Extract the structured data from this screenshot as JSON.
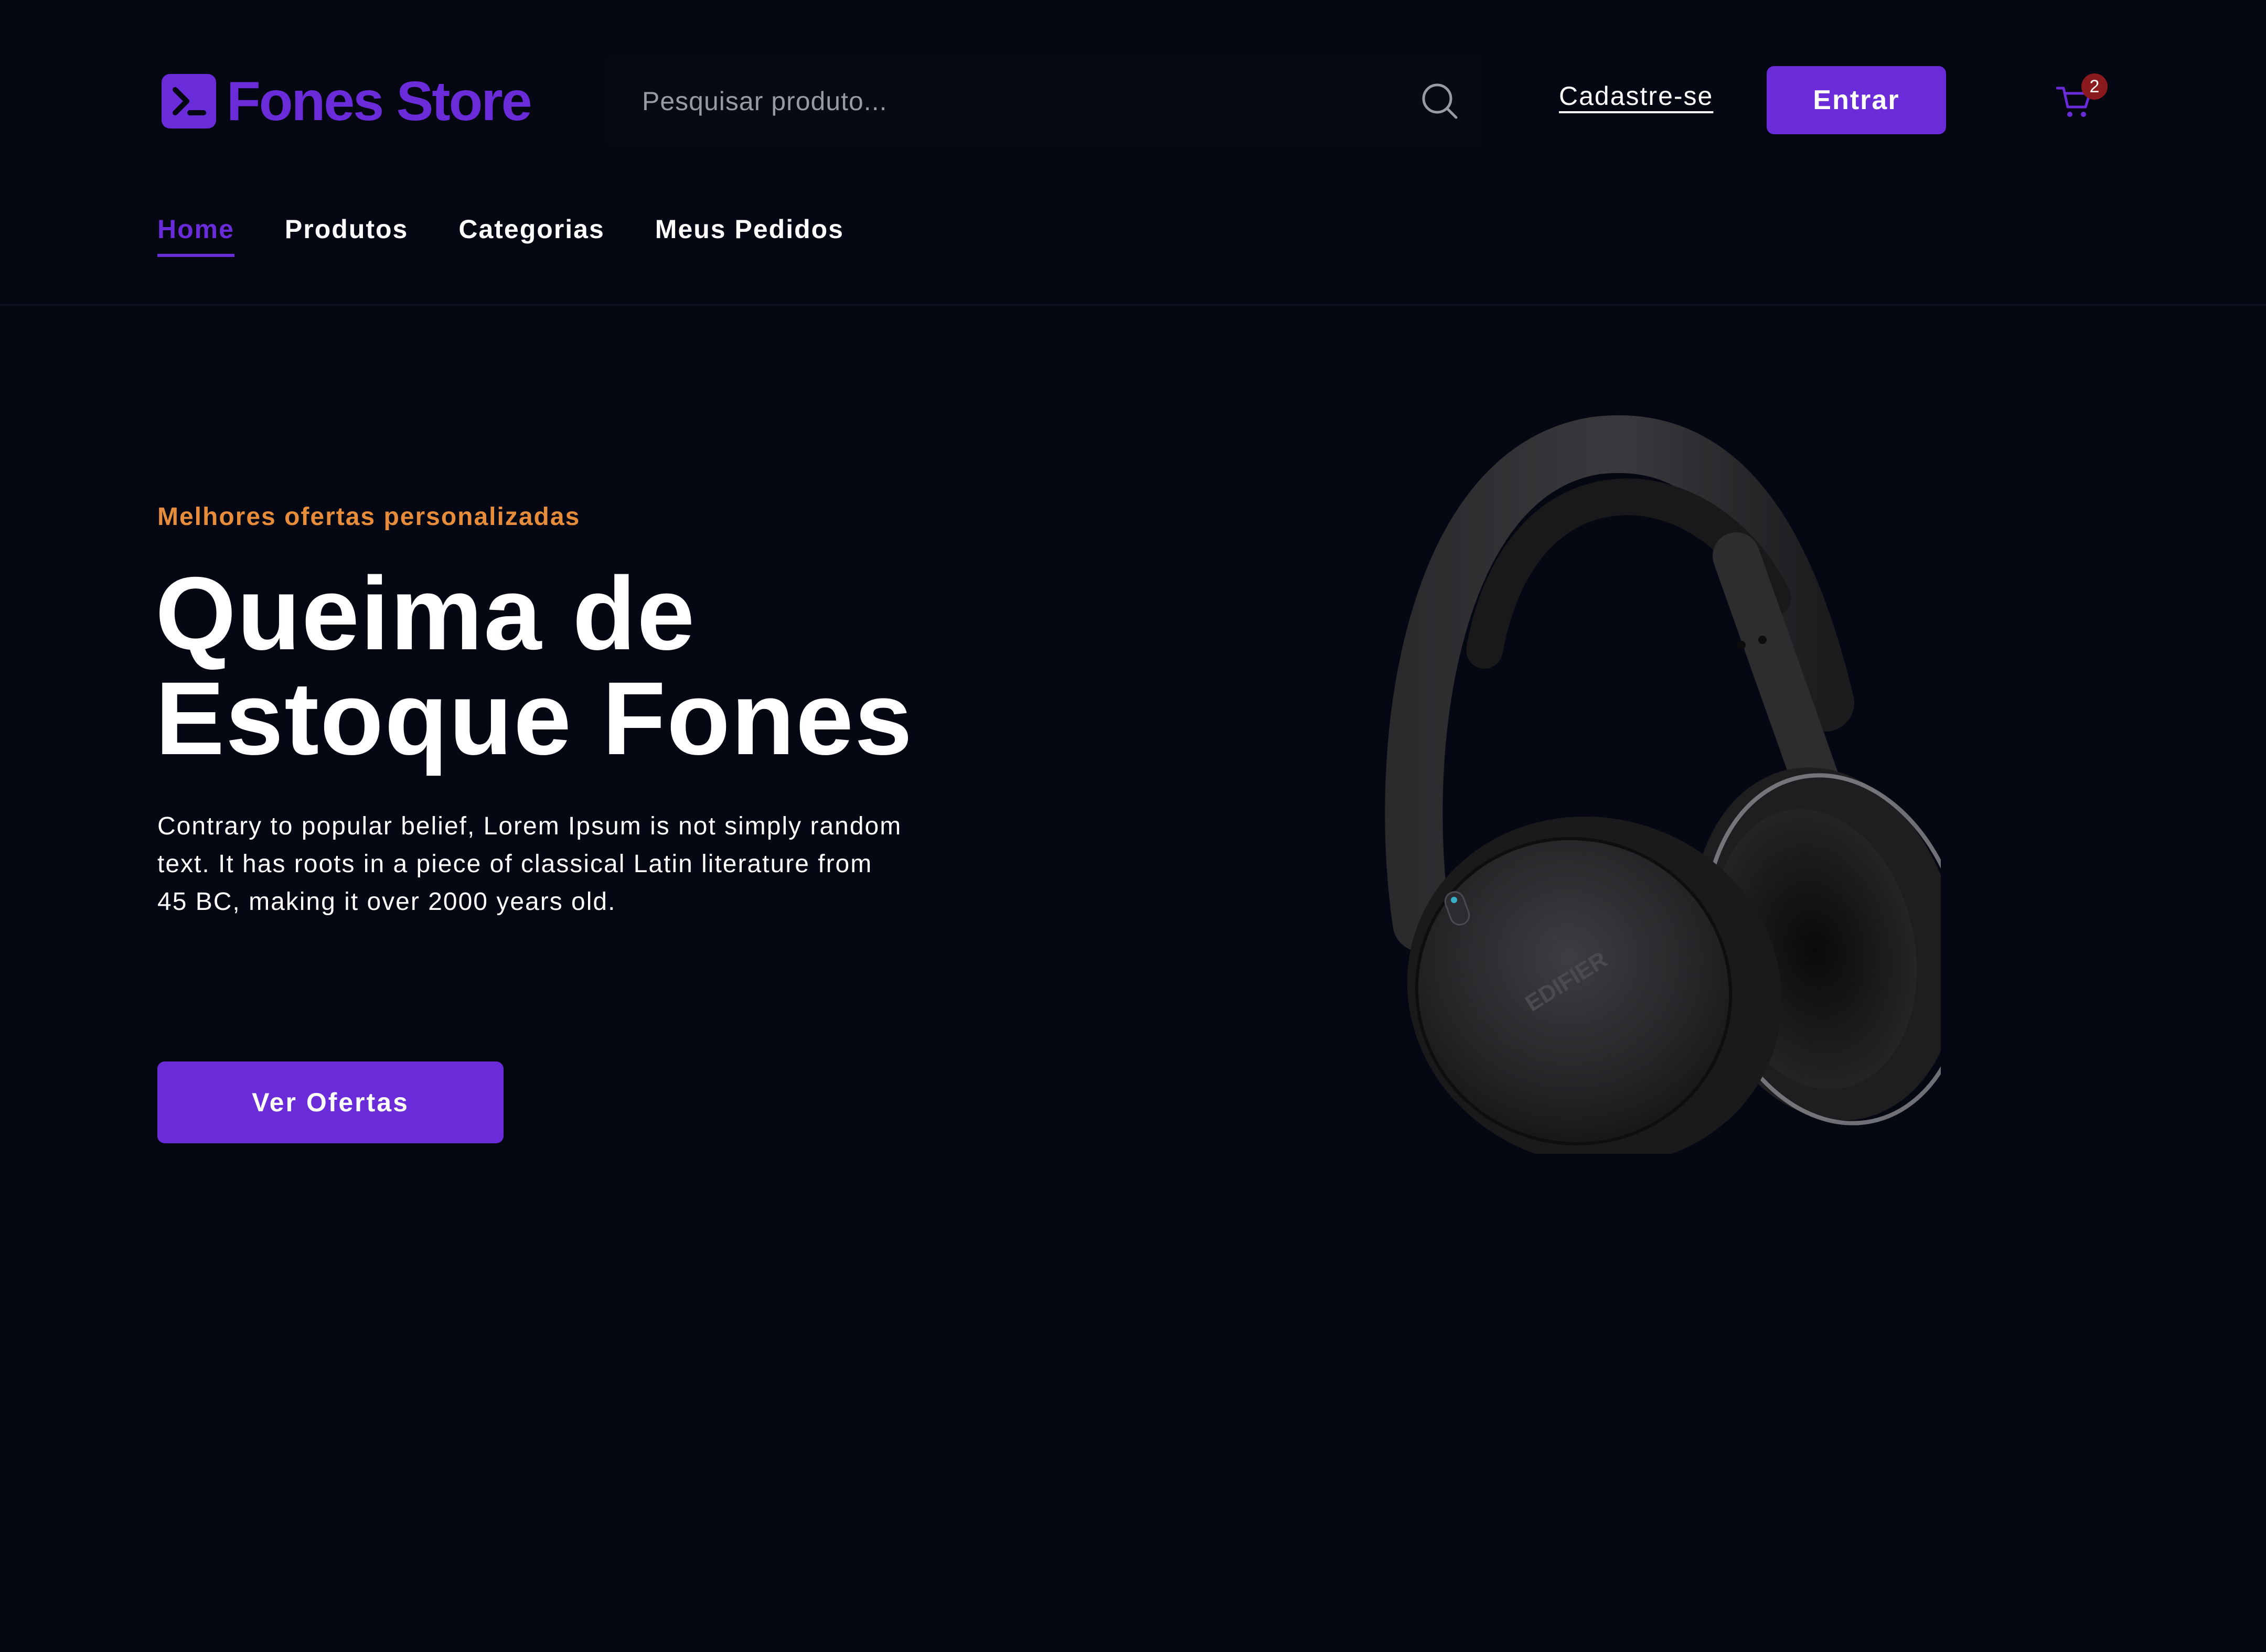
{
  "brand": {
    "name": "Fones Store",
    "accent": "#6a2bd9",
    "logo_icon": "terminal-prompt-icon"
  },
  "search": {
    "placeholder": "Pesquisar produto...",
    "icon": "search-icon"
  },
  "header": {
    "signup_label": "Cadastre-se",
    "login_label": "Entrar",
    "cart_icon": "cart-icon",
    "cart_count": "2"
  },
  "nav": {
    "items": [
      {
        "label": "Home",
        "active": true
      },
      {
        "label": "Produtos",
        "active": false
      },
      {
        "label": "Categorias",
        "active": false
      },
      {
        "label": "Meus Pedidos",
        "active": false
      }
    ]
  },
  "hero": {
    "eyebrow": "Melhores ofertas personalizadas",
    "title_line1": "Queima de",
    "title_line2": "Estoque Fones",
    "description": "Contrary to popular belief, Lorem Ipsum is not simply random text. It has roots in a piece of classical Latin literature from 45 BC, making it over 2000 years old.",
    "cta_label": "Ver Ofertas",
    "image_brand_text": "EDIFIER",
    "eyebrow_color": "#e68c3a"
  },
  "colors": {
    "background": "#050713",
    "badge": "#8b1a1f"
  }
}
